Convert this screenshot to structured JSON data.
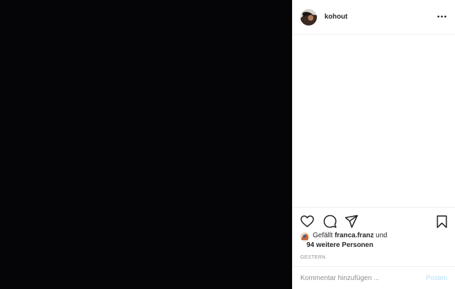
{
  "post": {
    "media": {
      "background_color": "#050507"
    },
    "header": {
      "username": "kohout",
      "more_icon": "more-horizontal-icon",
      "more_label": "···"
    },
    "actions": {
      "like_icon": "heart-outline-icon",
      "comment_icon": "comment-bubble-icon",
      "share_icon": "paper-plane-icon",
      "save_icon": "bookmark-outline-icon"
    },
    "likes": {
      "prefix": "Gefällt",
      "liker": "franca.franz",
      "conjunction": "und",
      "others": "94 weitere Personen"
    },
    "timestamp": "GESTERN",
    "comment_bar": {
      "placeholder": "Kommentar hinzufügen ...",
      "post_label": "Posten",
      "post_color": "#b2dffc"
    }
  }
}
